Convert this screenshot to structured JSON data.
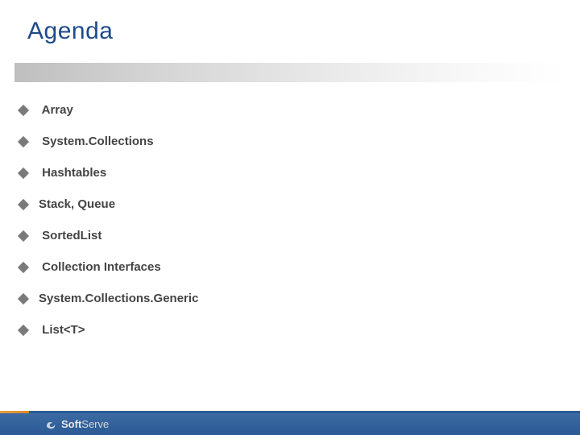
{
  "title": "Agenda",
  "items": [
    " Array",
    " System.Collections",
    " Hashtables",
    "Stack, Queue",
    " SortedList",
    " Collection Interfaces",
    "System.Collections.Generic",
    " List<T>"
  ],
  "footer": {
    "brand_a": "Soft",
    "brand_b": "Serve"
  }
}
